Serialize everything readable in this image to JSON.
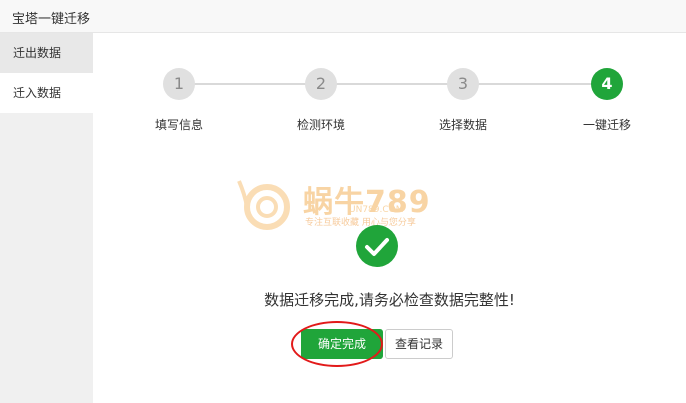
{
  "window": {
    "title": "宝塔一键迁移"
  },
  "sidebar": {
    "items": [
      {
        "label": "迁出数据"
      },
      {
        "label": "迁入数据"
      }
    ]
  },
  "steps": [
    {
      "number": "1",
      "label": "填写信息"
    },
    {
      "number": "2",
      "label": "检测环境"
    },
    {
      "number": "3",
      "label": "选择数据"
    },
    {
      "number": "4",
      "label": "一键迁移"
    }
  ],
  "watermark": {
    "brand": "蜗牛789",
    "domain": "UN789.COM",
    "slogan": "专注互联收藏    用心与您分享"
  },
  "result": {
    "message": "数据迁移完成,请务必检查数据完整性!",
    "confirm_label": "确定完成",
    "log_label": "查看记录"
  },
  "colors": {
    "accent": "#20a53a",
    "highlight": "#e21a1a"
  }
}
